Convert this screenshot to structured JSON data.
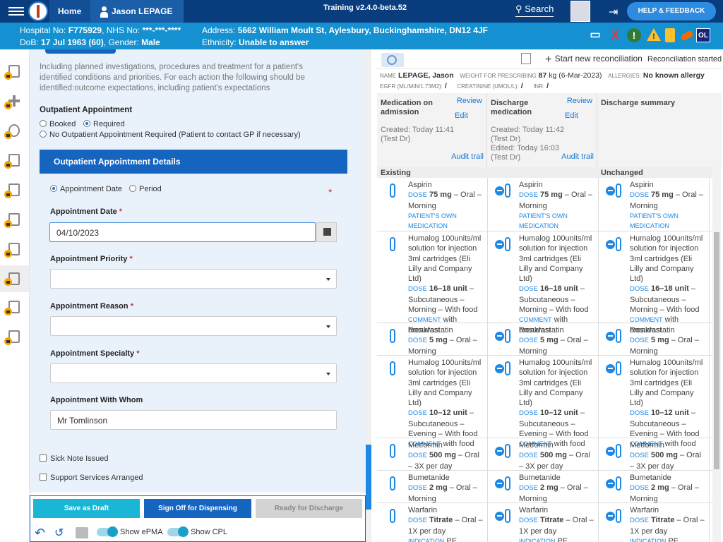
{
  "topbar": {
    "home": "Home",
    "patient_name": "Jason LEPAGE",
    "environment": "Training v2.4.0-beta.52",
    "search": "Search",
    "help": "HELP & FEEDBACK"
  },
  "patient_banner": {
    "line1_left_label": "Hospital No:",
    "hospital_no": "F775929",
    "nhs_label": "NHS No:",
    "nhs_no": "***-***-****",
    "line2_left_label": "DoB:",
    "dob": "17 Jul 1963 (60)",
    "gender_label": "Gender:",
    "gender": "Male",
    "address_label": "Address:",
    "address": "5662 William Moult St, Aylesbury, Buckinghamshire, DN12 4JF",
    "ethnicity_label": "Ethnicity:",
    "ethnicity": "Unable to answer",
    "alert_x": "X",
    "alert_excl": "!",
    "alert_warn": "!",
    "alert_ol": "OL"
  },
  "form": {
    "intro": "Including planned investigations, procedures and treatment for a patient's identified conditions and priorities. For each action the following should be identified:outcome expectations, including patient's expectations",
    "outpatient_label": "Outpatient Appointment",
    "opt_booked": "Booked",
    "opt_required": "Required",
    "opt_none": "No Outpatient Appointment Required (Patient to contact GP if necessary)",
    "section_title": "Outpatient Appointment Details",
    "opt_date": "Appointment Date",
    "opt_period": "Period",
    "date_label": "Appointment Date",
    "date_value": "04/10/2023",
    "priority_label": "Appointment Priority",
    "reason_label": "Appointment Reason",
    "specialty_label": "Appointment Specialty",
    "whom_label": "Appointment With Whom",
    "whom_value": "Mr Tomlinson",
    "sick_note": "Sick Note Issued",
    "support": "Support Services Arranged",
    "required_mark": "*"
  },
  "actions": {
    "save_draft": "Save as Draft",
    "sign_off": "Sign Off for Dispensing",
    "ready": "Ready for Discharge",
    "show_epma": "Show ePMA",
    "show_cpl": "Show CPL"
  },
  "recon": {
    "start": "Start new reconciliation",
    "started": "Reconciliation started",
    "name_label": "NAME",
    "name": "LEPAGE, Jason",
    "weight_label": "WEIGHT FOR PRESCRIBING",
    "weight": "87",
    "weight_unit": "kg",
    "weight_date": "(6-Mar-2023)",
    "allergies_label": "ALLERGIES:",
    "allergies": "No known allergy",
    "egfr_label": "EGFR (ML/MIN/1.73M2):",
    "egfr": "/",
    "creat_label": "CREATININE (UMOL/L):",
    "creat": "/",
    "inr_label": "INR:",
    "inr": "/",
    "columns": [
      {
        "title": "Medication on admission",
        "review": "Review",
        "edit": "Edit",
        "created": "Created: Today 11:41",
        "by": "(Test Dr)",
        "edited": "",
        "by2": "",
        "audit": "Audit trail"
      },
      {
        "title": "Discharge medication",
        "review": "Review",
        "edit": "Edit",
        "created": "Created: Today 11:42",
        "by": "(Test Dr)",
        "edited": "Edited: Today 16:03",
        "by2": "(Test Dr)",
        "audit": "Audit trail"
      },
      {
        "title": "Discharge summary",
        "review": "",
        "edit": "",
        "created": "",
        "by": "",
        "edited": "",
        "by2": "",
        "audit": ""
      }
    ],
    "groups": [
      "Existing",
      "Unchanged"
    ],
    "meds": [
      {
        "name": "Aspirin",
        "dose": "75 mg",
        "rest": "– Oral – Morning",
        "note_label": "PATIENT'S OWN MEDICATION",
        "note": ""
      },
      {
        "name": "Humalog 100units/ml solution for injection 3ml cartridges (Eli Lilly and Company Ltd)",
        "dose": "16–18 unit",
        "rest": "– Subcutaneous – Morning – With food",
        "note_label": "COMMENT",
        "note": "with breakfast"
      },
      {
        "name": "Rosuvastatin",
        "dose": "5 mg",
        "rest": "– Oral – Morning",
        "note_label": "",
        "note": ""
      },
      {
        "name": "Humalog 100units/ml solution for injection 3ml cartridges (Eli Lilly and Company Ltd)",
        "dose": "10–12 unit",
        "rest": "– Subcutaneous – Evening – With food",
        "note_label": "COMMENT",
        "note": "with food"
      },
      {
        "name": "Metformin",
        "dose": "500 mg",
        "rest": "– Oral – 3X per day",
        "note_label": "",
        "note": ""
      },
      {
        "name": "Bumetanide",
        "dose": "2 mg",
        "rest": "– Oral – Morning",
        "note_label": "",
        "note": ""
      },
      {
        "name": "Warfarin",
        "dose": "Titrate",
        "rest": "– Oral – 1X per day",
        "note_label": "INDICATION",
        "note": "PE"
      }
    ],
    "dose_label": "DOSE"
  }
}
